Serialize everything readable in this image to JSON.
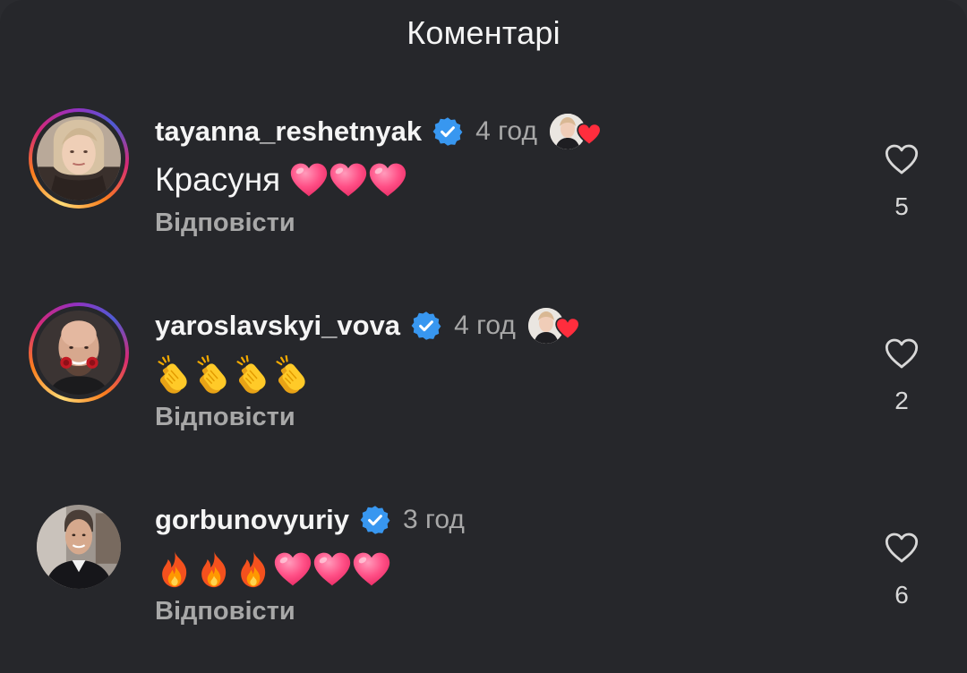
{
  "header": {
    "title": "Коментарі"
  },
  "reply_label": "Відповісти",
  "colors": {
    "verified": "#3897f0",
    "heart_red": "#ff3040",
    "pink_heart": "#ff4a83"
  },
  "comments": [
    {
      "username": "tayanna_reshetnyak",
      "verified": true,
      "time": "4 год",
      "liked_by_author": true,
      "text": "Красуня",
      "emojis": [
        "pink-heart",
        "pink-heart",
        "pink-heart"
      ],
      "reply_label": "Відповісти",
      "like_count": "5"
    },
    {
      "username": "yaroslavskyi_vova",
      "verified": true,
      "time": "4 год",
      "liked_by_author": true,
      "text": "",
      "emojis": [
        "clapping-hands",
        "clapping-hands",
        "clapping-hands",
        "clapping-hands"
      ],
      "reply_label": "Відповісти",
      "like_count": "2"
    },
    {
      "username": "gorbunovyuriy",
      "verified": true,
      "time": "3 год",
      "liked_by_author": false,
      "text": "",
      "emojis": [
        "fire",
        "fire",
        "fire",
        "pink-heart",
        "pink-heart",
        "pink-heart"
      ],
      "reply_label": "Відповісти",
      "like_count": "6"
    }
  ]
}
